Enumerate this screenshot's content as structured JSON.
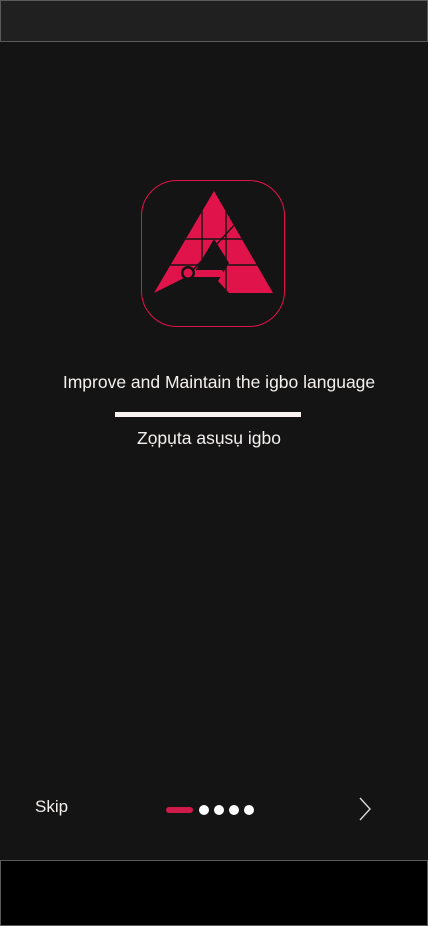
{
  "onboarding": {
    "headline": "Improve and Maintain the igbo language",
    "subline": "Zọpụta asụsụ igbo",
    "skip_label": "Skip",
    "total_pages": 5,
    "current_page": 1
  },
  "icons": {
    "logo": "triangle-a-logo-icon",
    "next": "chevron-right-icon"
  },
  "colors": {
    "accent": "#e0134a",
    "background": "#141414",
    "text": "#f4f0ee",
    "active_dot": "#d01a4a"
  }
}
